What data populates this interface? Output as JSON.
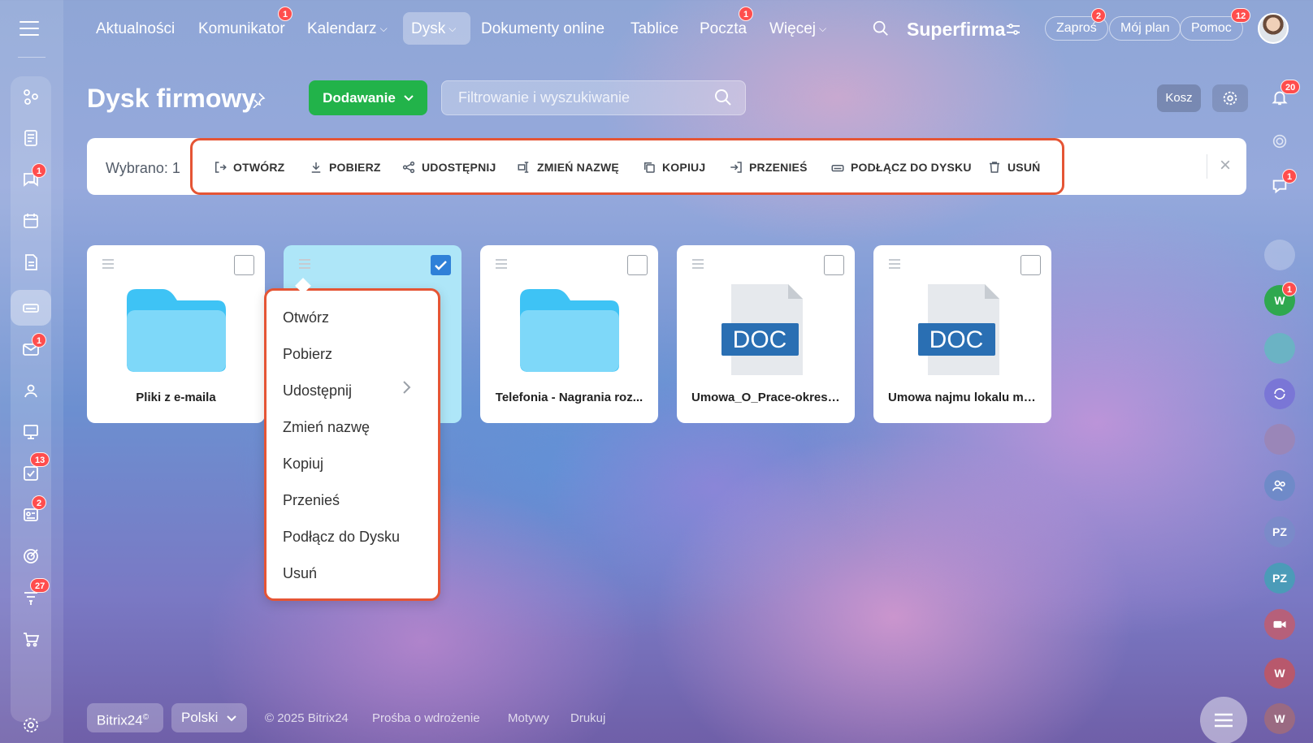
{
  "topnav": {
    "items": [
      {
        "label": "Aktualności"
      },
      {
        "label": "Komunikator",
        "badge": "1"
      },
      {
        "label": "Kalendarz"
      },
      {
        "label": "Dysk"
      },
      {
        "label": "Dokumenty online"
      },
      {
        "label": "Tablice"
      },
      {
        "label": "Poczta",
        "badge": "1"
      },
      {
        "label": "Więcej"
      }
    ],
    "brand": "Superfirma",
    "invite": {
      "label": "Zaproś",
      "badge": "2"
    },
    "plan": "Mój plan",
    "help": {
      "label": "Pomoc",
      "badge": "12"
    }
  },
  "sidebar": {
    "badges": {
      "chat": "1",
      "mail": "1",
      "tasks": "13",
      "crm": "2",
      "sales": "27"
    }
  },
  "page": {
    "title": "Dysk firmowy",
    "add_button": "Dodawanie",
    "filter_placeholder": "Filtrowanie i wyszukiwanie",
    "trash": "Kosz",
    "notifications_badge": "20",
    "right_chat_badge": "1",
    "right_w_badge": "1"
  },
  "actionbar": {
    "selected": "Wybrano: 1",
    "actions": [
      "OTWÓRZ",
      "POBIERZ",
      "UDOSTĘPNIJ",
      "ZMIEŃ NAZWĘ",
      "KOPIUJ",
      "PRZENIEŚ",
      "PODŁĄCZ DO DYSKU",
      "USUŃ"
    ]
  },
  "files": [
    {
      "name": "Pliki z e-maila",
      "type": "folder",
      "selected": false
    },
    {
      "name": "",
      "type": "folder",
      "selected": true
    },
    {
      "name": "Telefonia - Nagrania roz...",
      "type": "folder",
      "selected": false
    },
    {
      "name": "Umowa_O_Prace-okres-p...",
      "type": "doc",
      "selected": false
    },
    {
      "name": "Umowa najmu lokalu mi...",
      "type": "doc",
      "selected": false
    }
  ],
  "doc_label": "DOC",
  "context_menu": [
    "Otwórz",
    "Pobierz",
    "Udostępnij",
    "Zmień nazwę",
    "Kopiuj",
    "Przenieś",
    "Podłącz do Dysku",
    "Usuń"
  ],
  "right_rail": {
    "avatars": [
      "W",
      "PZ",
      "PZ",
      "W",
      "W"
    ]
  },
  "footer": {
    "brand": "Bitrix24",
    "brand_mark": "©",
    "language": "Polski",
    "copyright": "© 2025 Bitrix24",
    "links": [
      "Prośba o wdrożenie",
      "Motywy",
      "Drukuj"
    ]
  },
  "colors": {
    "accent_green": "#22b34a",
    "highlight": "#e55535",
    "checkbox_blue": "#2f80d8",
    "folder": "#3ec3f5",
    "doc_blue": "#2a6fb3"
  }
}
